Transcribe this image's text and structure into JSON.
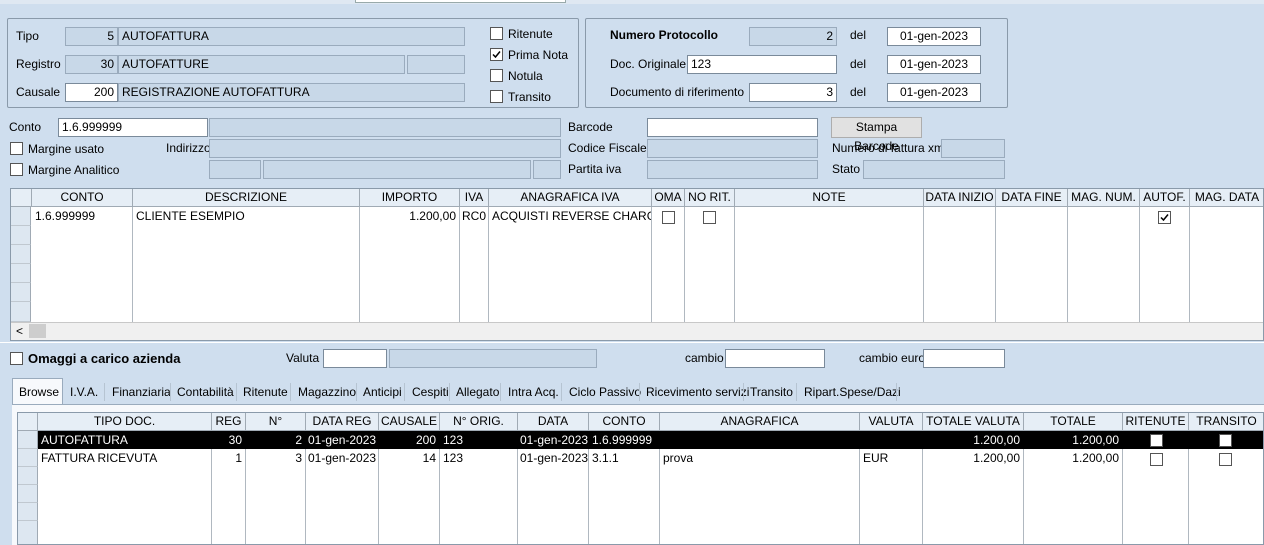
{
  "header": {
    "tipo_label": "Tipo",
    "tipo_code": "5",
    "tipo_desc": "AUTOFATTURA",
    "registro_label": "Registro",
    "registro_code": "30",
    "registro_desc": "AUTOFATTURE",
    "causale_label": "Causale",
    "causale_code": "200",
    "causale_desc": "REGISTRAZIONE AUTOFATTURA",
    "ritenute_label": "Ritenute",
    "ritenute_checked": false,
    "prima_nota_label": "Prima Nota",
    "prima_nota_checked": true,
    "notula_label": "Notula",
    "notula_checked": false,
    "transito_label": "Transito",
    "transito_checked": false
  },
  "protocollo": {
    "numero_label": "Numero Protocollo",
    "numero_value": "2",
    "del1": "del",
    "data1": "01-gen-2023",
    "doc_orig_label": "Doc. Originale",
    "doc_orig_value": "123",
    "del2": "del",
    "data2": "01-gen-2023",
    "doc_rif_label": "Documento di riferimento",
    "doc_rif_value": "3",
    "del3": "del",
    "data3": "01-gen-2023"
  },
  "conto": {
    "conto_label": "Conto",
    "conto_value": "1.6.999999",
    "margine_usato_label": "Margine usato",
    "indirizzo_label": "Indirizzo",
    "margine_analitico_label": "Margine Analitico",
    "barcode_label": "Barcode",
    "stampa_barcode": "Stampa Barcode",
    "codice_fiscale_label": "Codice Fiscale",
    "numero_fattura_xml_label": "Numero di fattura xml",
    "partita_iva_label": "Partita iva",
    "stato_label": "Stato"
  },
  "righe": {
    "columns": [
      "CONTO",
      "DESCRIZIONE",
      "IMPORTO",
      "IVA",
      "ANAGRAFICA IVA",
      "OMA",
      "NO RIT.",
      "NOTE",
      "DATA INIZIO",
      "DATA FINE",
      "MAG. NUM.",
      "AUTOF.",
      "MAG. DATA"
    ],
    "rows": [
      {
        "conto": "1.6.999999",
        "descrizione": "CLIENTE ESEMPIO",
        "importo": "1.200,00",
        "iva": "RC0",
        "anagrafica": "ACQUISTI REVERSE CHARGE",
        "oma": false,
        "norit": false,
        "autof": true
      }
    ],
    "scroll_left": "<"
  },
  "omaggi": {
    "label": "Omaggi a carico azienda",
    "valuta_label": "Valuta",
    "cambio_label": "cambio",
    "cambio_euro_label": "cambio euro"
  },
  "tabs": [
    "Browse",
    "I.V.A.",
    "Finanziaria",
    "Contabilità",
    "Ritenute",
    "Magazzino",
    "Anticipi",
    "Cespiti",
    "Allegato",
    "Intra Acq.",
    "Ciclo Passivo",
    "Ricevimento servizi",
    "Transito",
    "Ripart.Spese/Dazi"
  ],
  "browse": {
    "columns": [
      "TIPO DOC.",
      "REG",
      "N°",
      "DATA REG",
      "CAUSALE",
      "N° ORIG.",
      "DATA",
      "CONTO",
      "ANAGRAFICA",
      "VALUTA",
      "TOTALE VALUTA",
      "TOTALE",
      "RITENUTE",
      "TRANSITO"
    ],
    "rows": [
      {
        "tipo": "AUTOFATTURA",
        "reg": "30",
        "n": "2",
        "data_reg": "01-gen-2023",
        "causale": "200",
        "n_orig": "123",
        "data": "01-gen-2023",
        "conto": "1.6.999999",
        "anagrafica": "",
        "valuta": "",
        "tot_valuta": "1.200,00",
        "totale": "1.200,00",
        "selected": true
      },
      {
        "tipo": "FATTURA RICEVUTA",
        "reg": "1",
        "n": "3",
        "data_reg": "01-gen-2023",
        "causale": "14",
        "n_orig": "123",
        "data": "01-gen-2023",
        "conto": "3.1.1",
        "anagrafica": "prova",
        "valuta": "EUR",
        "tot_valuta": "1.200,00",
        "totale": "1.200,00",
        "selected": false
      }
    ]
  },
  "colors": {
    "background": "#cfdeee",
    "selected_row": "#000000",
    "readonly": "#c8d8e8"
  }
}
